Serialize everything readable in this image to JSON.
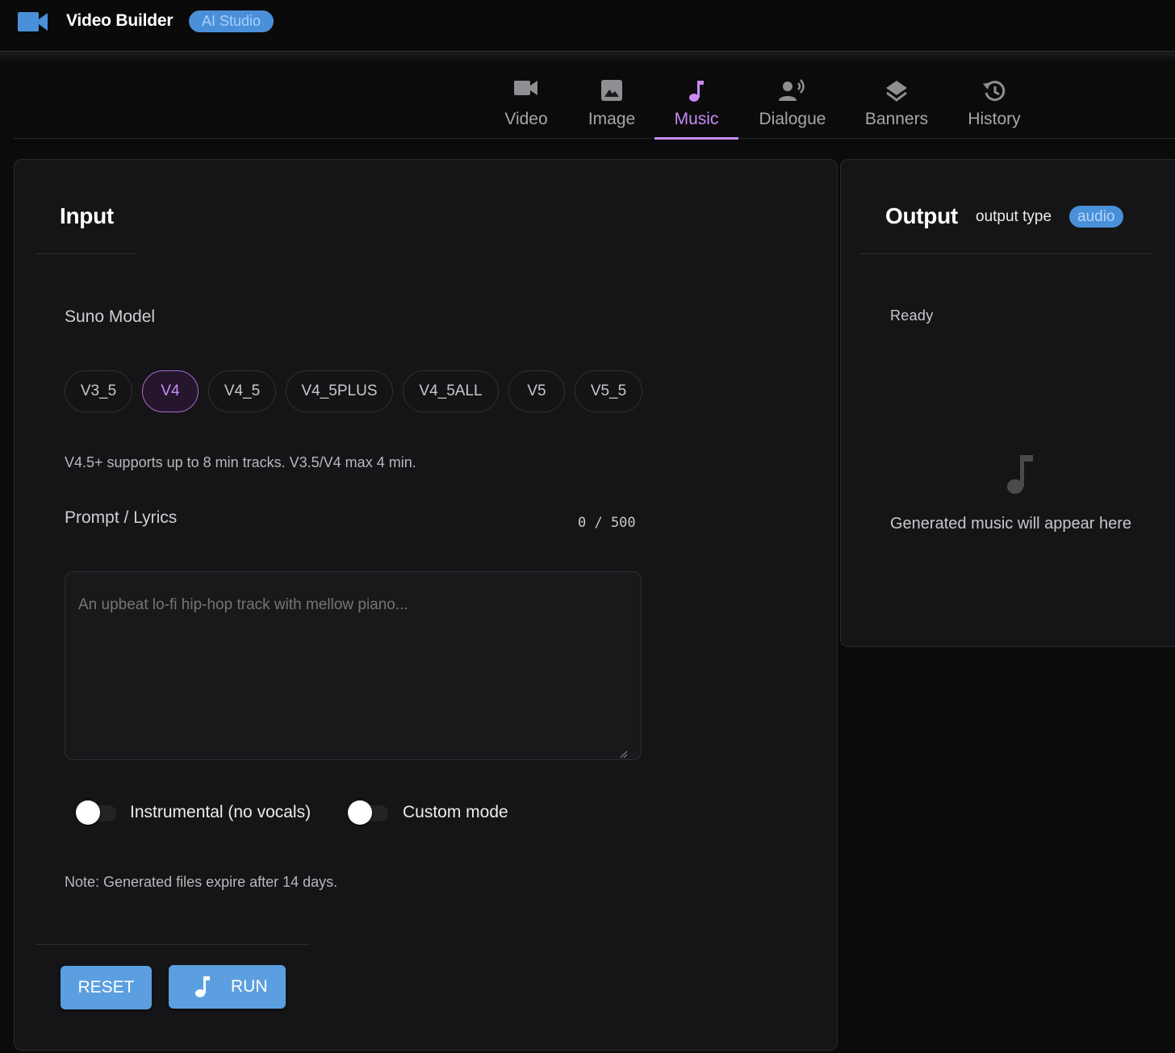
{
  "app": {
    "title": "Video Builder",
    "badge": "AI Studio",
    "logo_icon": "video-camera-icon"
  },
  "tabs": [
    {
      "label": "Video",
      "icon": "video-camera-icon",
      "active": false
    },
    {
      "label": "Image",
      "icon": "image-icon",
      "active": false
    },
    {
      "label": "Music",
      "icon": "music-note-icon",
      "active": true
    },
    {
      "label": "Dialogue",
      "icon": "speaking-person-icon",
      "active": false
    },
    {
      "label": "Banners",
      "icon": "layers-icon",
      "active": false
    },
    {
      "label": "History",
      "icon": "history-icon",
      "active": false
    }
  ],
  "input_panel": {
    "title": "Input",
    "model_label": "Suno Model",
    "models": [
      "V3_5",
      "V4",
      "V4_5",
      "V4_5PLUS",
      "V4_5ALL",
      "V5",
      "V5_5"
    ],
    "selected_model": "V4",
    "model_hint": "V4.5+ supports up to 8 min tracks. V3.5/V4 max 4 min.",
    "prompt_label": "Prompt / Lyrics",
    "char_count": "0 / 500",
    "prompt_value": "",
    "prompt_placeholder": "An upbeat lo-fi hip-hop track with mellow piano...",
    "toggles": [
      {
        "label": "Instrumental (no vocals)",
        "on": false
      },
      {
        "label": "Custom mode",
        "on": false
      }
    ],
    "note": "Note: Generated files expire after 14 days.",
    "reset_label": "RESET",
    "run_label": "RUN",
    "run_icon": "music-note-icon"
  },
  "output_panel": {
    "title": "Output",
    "type_label": "output type",
    "type_value": "audio",
    "status": "Ready",
    "empty_icon": "music-note-icon",
    "empty_message": "Generated music will appear here"
  },
  "colors": {
    "accent_purple": "#c98bf2",
    "accent_blue": "#5b9fe0",
    "chip_blue": "#4a90d9",
    "background": "#0b0b0c",
    "panel": "#151517"
  }
}
